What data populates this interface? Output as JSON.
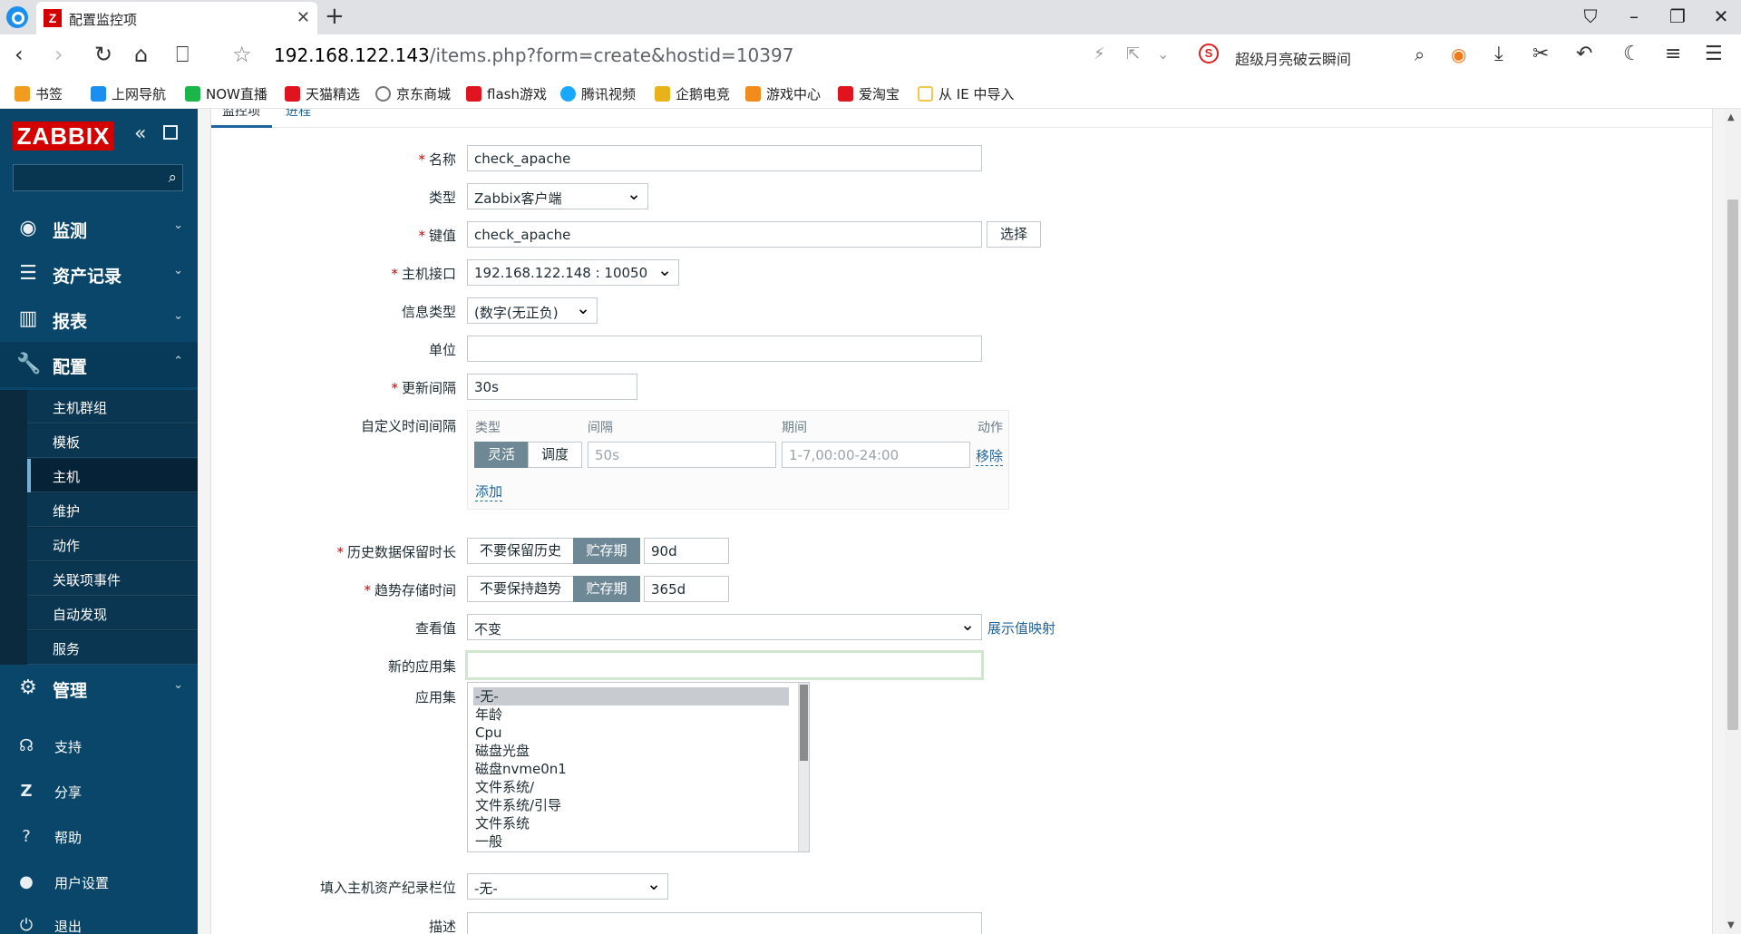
{
  "browser": {
    "tab_title": "配置监控项",
    "tab_favicon": "Z",
    "url_host": "192.168.122.143",
    "url_path": "/items.php?form=create&hostid=10397",
    "search_engine_icon": "S",
    "search_hot": "超级月亮破云瞬间",
    "bookmarks": [
      {
        "label": "书签",
        "icon": "star-icon",
        "color": "#f29c1f"
      },
      {
        "label": "上网导航",
        "icon": "e-icon",
        "color": "#1a8ff0"
      },
      {
        "label": "NOW直播",
        "icon": "now-icon",
        "color": "#1ab64a"
      },
      {
        "label": "天猫精选",
        "icon": "tmall-icon",
        "color": "#e0141e"
      },
      {
        "label": "京东商城",
        "icon": "globe-icon",
        "color": "#777777"
      },
      {
        "label": "flash游戏",
        "icon": "flash-icon",
        "color": "#e0141e"
      },
      {
        "label": "腾讯视频",
        "icon": "play-icon",
        "color": "#19a8ff"
      },
      {
        "label": "企鹅电竞",
        "icon": "penguin-icon",
        "color": "#e7b21a"
      },
      {
        "label": "游戏中心",
        "icon": "gamepad-icon",
        "color": "#f18b1b"
      },
      {
        "label": "爱淘宝",
        "icon": "taobao-icon",
        "color": "#e0141e"
      },
      {
        "label": "从 IE 中导入",
        "icon": "folder-icon",
        "color": "#f2c94c"
      }
    ]
  },
  "sidebar": {
    "logo": "ZABBIX",
    "search_placeholder": "",
    "menus": [
      {
        "label": "监测",
        "icon": "eye-icon"
      },
      {
        "label": "资产记录",
        "icon": "list-icon"
      },
      {
        "label": "报表",
        "icon": "chart-icon"
      },
      {
        "label": "配置",
        "icon": "wrench-icon"
      },
      {
        "label": "管理",
        "icon": "gear-icon"
      }
    ],
    "config_submenu": [
      "主机群组",
      "模板",
      "主机",
      "维护",
      "动作",
      "关联项事件",
      "自动发现",
      "服务"
    ],
    "bottom": [
      {
        "label": "支持",
        "icon": "headset-icon"
      },
      {
        "label": "分享",
        "icon": "share-icon"
      },
      {
        "label": "帮助",
        "icon": "help-icon"
      },
      {
        "label": "用户设置",
        "icon": "user-icon"
      },
      {
        "label": "退出",
        "icon": "power-icon"
      }
    ]
  },
  "form": {
    "tabs": [
      "监控项",
      "进程"
    ],
    "name_label": "名称",
    "name_value": "check_apache",
    "type_label": "类型",
    "type_value": "Zabbix客户端",
    "key_label": "键值",
    "key_value": "check_apache",
    "select_button": "选择",
    "interface_label": "主机接口",
    "interface_value": "192.168.122.148 : 10050",
    "info_type_label": "信息类型",
    "info_type_value": "(数字(无正负)",
    "units_label": "单位",
    "units_value": "",
    "update_label": "更新间隔",
    "update_value": "30s",
    "custom_label": "自定义时间间隔",
    "custom": {
      "headers": [
        "类型",
        "间隔",
        "期间",
        "动作"
      ],
      "flexible": "灵活",
      "scheduling": "调度",
      "interval_placeholder": "50s",
      "period_placeholder": "1-7,00:00-24:00",
      "remove": "移除",
      "add": "添加"
    },
    "history_label": "历史数据保留时长",
    "history_no": "不要保留历史",
    "history_storage": "贮存期",
    "history_value": "90d",
    "trends_label": "趋势存储时间",
    "trends_no": "不要保持趋势",
    "trends_storage": "贮存期",
    "trends_value": "365d",
    "show_value_label": "查看值",
    "show_value_value": "不变",
    "show_value_link": "展示值映射",
    "new_app_label": "新的应用集",
    "new_app_value": "",
    "apps_label": "应用集",
    "apps": [
      "-无-",
      "年龄",
      "Cpu",
      "磁盘光盘",
      "磁盘nvme0n1",
      "文件系统/",
      "文件系统/引导",
      "文件系统",
      "一般"
    ],
    "inventory_label": "填入主机资产纪录栏位",
    "inventory_value": "-无-",
    "desc_label": "描述",
    "desc_value": ""
  },
  "colors": {
    "accent": "#1f65a0",
    "brand": "#d40000",
    "sidebar": "#0a466a",
    "active_seg": "#6e8896"
  }
}
